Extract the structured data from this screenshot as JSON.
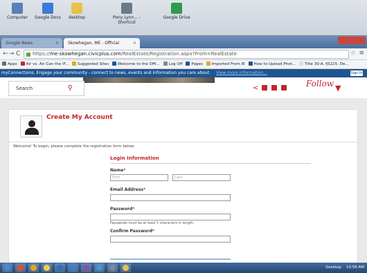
{
  "desktop": {
    "icons": [
      {
        "label": "Computer",
        "color": "#5a7fb8"
      },
      {
        "label": "Google Docs",
        "color": "#3c7bd6"
      },
      {
        "label": "desktop",
        "color": "#e6c24a"
      },
      {
        "label": "Pony Lynn... - Shortcut",
        "color": "#6b7a8a"
      },
      {
        "label": "Google Drive",
        "color": "#2e9b4b"
      }
    ]
  },
  "browser": {
    "tabs": [
      {
        "label": "Google News",
        "active": false
      },
      {
        "label": "Skowhegan, ME - Official",
        "active": true
      }
    ],
    "nav": {
      "back": "←",
      "forward": "→",
      "reload": "C"
    },
    "url_prefix": "https://",
    "url_host": "me-skowhegan.civicplus.com",
    "url_path": "/RealEstate/Registration.aspx?From=RealEstate",
    "star": "☆",
    "menu": "≡",
    "bookmarks": [
      {
        "label": "Apps",
        "color": "#6b6b6b"
      },
      {
        "label": "Air vs. Air Can the iF...",
        "color": "#c0282b"
      },
      {
        "label": "Suggested Sites",
        "color": "#e0a81f"
      },
      {
        "label": "Welcome to the Offi...",
        "color": "#1e5591"
      },
      {
        "label": "Log Off",
        "color": "#888"
      },
      {
        "label": "Pages",
        "color": "#1e5591"
      },
      {
        "label": "Imported From IE",
        "color": "#e0a81f"
      },
      {
        "label": "How to Upload Phot...",
        "color": "#1e5591"
      },
      {
        "label": "Title 30-A, §5225. De...",
        "color": "#ddd"
      }
    ]
  },
  "page": {
    "topbar": {
      "text": "myConnections: Engage your community - connect to news, events and information you care about.",
      "more": "View more information...",
      "signin": "Sign In"
    },
    "search": {
      "label": "Search"
    },
    "social_colors": [
      "#c0282b",
      "#c0282b",
      "#c0282b",
      "#c0282b"
    ],
    "follow": "Follow",
    "title": "Create My Account",
    "welcome": "Welcome! To begin, please complete the registration form below.",
    "form": {
      "section": "Login Information",
      "name_label": "Name",
      "first_placeholder": "First",
      "last_placeholder": "Last",
      "email_label": "Email Address",
      "password_label": "Password",
      "password_hint": "Passwords must be at least 5 characters in length.",
      "confirm_label": "Confirm Password",
      "required": "*"
    }
  },
  "taskbar": {
    "apps": [
      "#3f8fd6",
      "#e4502c",
      "#e0a81f",
      "#f5d04a",
      "#2e6fc0",
      "#3c7bd6",
      "#8a4fb0",
      "#3c9bd6",
      "#7a8a9a",
      "#e6c24a"
    ],
    "tray_text": "Desktop",
    "clock": "10:56 AM"
  }
}
